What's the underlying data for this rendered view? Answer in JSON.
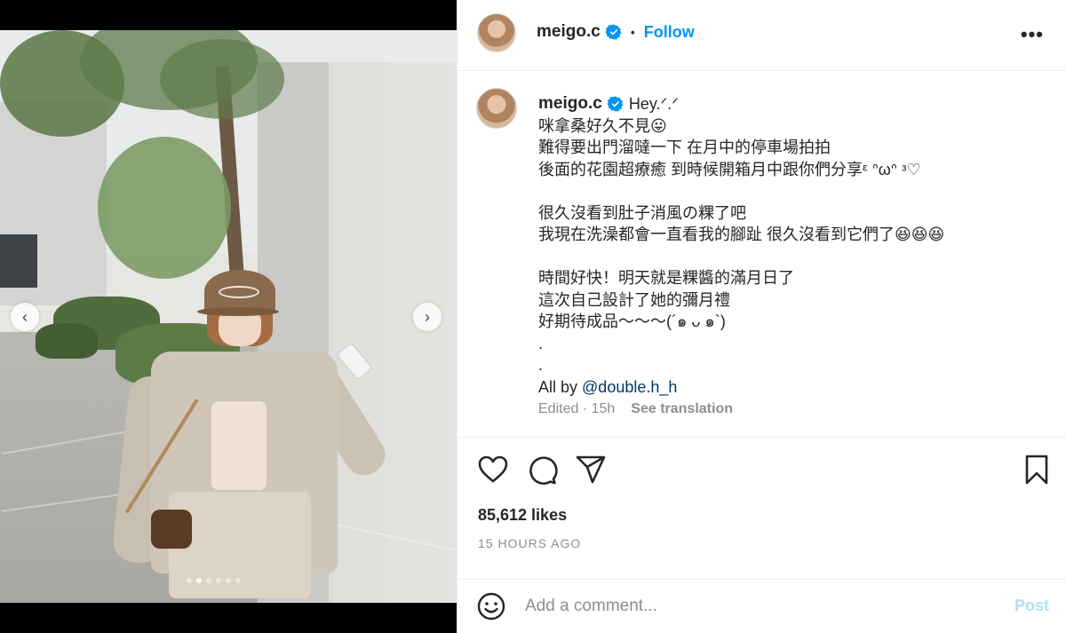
{
  "post": {
    "username": "meigo.c",
    "follow_label": "Follow",
    "header_separator": "•",
    "more_label": "•••"
  },
  "media": {
    "prev_label": "‹",
    "next_label": "›",
    "slide_count": 6,
    "active_slide": 1
  },
  "caption": {
    "first_line": "Hey.ᐟ.ᐟ",
    "lines": [
      "咪拿桑好久不見😛",
      "難得要出門溜噠一下 在月中的停車場拍拍",
      "後面的花園超療癒 到時候開箱月中跟你們分享ᵋ ᐢωᐢ ᵌ♡",
      "",
      "很久沒看到肚子消風の粿了吧",
      "我現在洗澡都會一直看我的腳趾 很久沒看到它們了😆😆😆",
      "",
      "時間好快！明天就是粿醬的滿月日了",
      "這次自己設計了她的彌月禮",
      "好期待成品～～～(´๑ ᴗ ๑`)",
      ".",
      "."
    ],
    "credit_prefix": "All by ",
    "credit_mention": "@double.h_h",
    "edited_label": "Edited · 15h",
    "see_translation": "See translation"
  },
  "engagement": {
    "likes": "85,612 likes",
    "timestamp": "15 HOURS AGO"
  },
  "comment": {
    "placeholder": "Add a comment...",
    "post_label": "Post"
  },
  "icons": {
    "like": "heart-icon",
    "comment": "comment-icon",
    "share": "paper-plane-icon",
    "save": "bookmark-icon",
    "emoji": "smiley-icon",
    "verified": "verified-badge-icon"
  },
  "colors": {
    "accent": "#0095f6",
    "post_disabled": "#b2dffc",
    "muted": "#8e8e8e",
    "mention": "#00376b"
  }
}
